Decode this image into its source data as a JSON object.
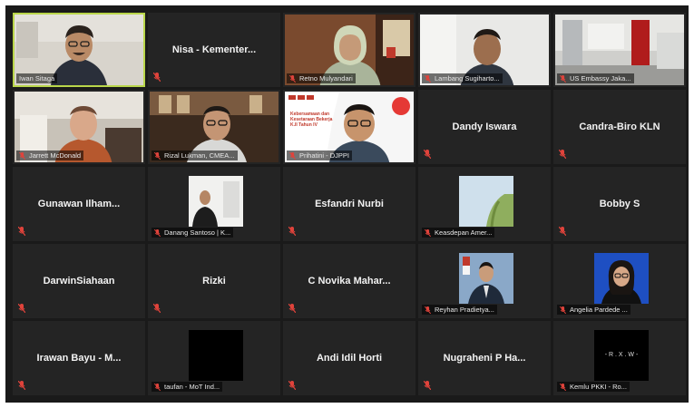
{
  "app": {
    "title": "Video meeting gallery view"
  },
  "colors": {
    "background": "#1a1a1a",
    "tile": "#242424",
    "active_speaker": "#b9d64a",
    "muted_icon": "#e0433b"
  },
  "participants": [
    {
      "id": "p1",
      "label": "Iwan Sitaga",
      "video": true,
      "active": true,
      "muted": false
    },
    {
      "id": "p2",
      "label": "Nisa - Kementer...",
      "video": false,
      "muted": true
    },
    {
      "id": "p3",
      "label": "Retno Mulyandari",
      "video": true,
      "muted": true
    },
    {
      "id": "p4",
      "label": "Lambang Sugiharto...",
      "video": true,
      "muted": true
    },
    {
      "id": "p5",
      "label": "US Embassy Jaka...",
      "video": true,
      "muted": true
    },
    {
      "id": "p6",
      "label": "Jarrett McDonald",
      "video": true,
      "muted": true
    },
    {
      "id": "p7",
      "label": "Rizal Lukman, CMEA...",
      "video": true,
      "muted": true
    },
    {
      "id": "p8",
      "label": "Prihatini - DJPPI",
      "video": true,
      "muted": true
    },
    {
      "id": "p9",
      "label": "Dandy Iswara",
      "video": false,
      "muted": true
    },
    {
      "id": "p10",
      "label": "Candra-Biro KLN",
      "video": false,
      "muted": true
    },
    {
      "id": "p11",
      "label": "Gunawan Ilham...",
      "video": false,
      "muted": true
    },
    {
      "id": "p12",
      "label": "Danang Santoso | K...",
      "video": true,
      "muted": true
    },
    {
      "id": "p13",
      "label": "Esfandri Nurbi",
      "video": false,
      "muted": true
    },
    {
      "id": "p14",
      "label": "Keasdepan Amer...",
      "video": true,
      "muted": true
    },
    {
      "id": "p15",
      "label": "Bobby S",
      "video": false,
      "muted": true
    },
    {
      "id": "p16",
      "label": "DarwinSiahaan",
      "video": false,
      "muted": true
    },
    {
      "id": "p17",
      "label": "Rizki",
      "video": false,
      "muted": true
    },
    {
      "id": "p18",
      "label": "C Novika Mahar...",
      "video": false,
      "muted": true
    },
    {
      "id": "p19",
      "label": "Reyhan Pradietya...",
      "video": true,
      "muted": true
    },
    {
      "id": "p20",
      "label": "Angelia Pardede ...",
      "video": true,
      "muted": true
    },
    {
      "id": "p21",
      "label": "Irawan Bayu - M...",
      "video": false,
      "muted": true
    },
    {
      "id": "p22",
      "label": "taufan - MoT Ind...",
      "video": true,
      "muted": true
    },
    {
      "id": "p23",
      "label": "Andi Idil Horti",
      "video": false,
      "muted": true
    },
    {
      "id": "p24",
      "label": "Nugraheni P Ha...",
      "video": false,
      "muted": true
    },
    {
      "id": "p25",
      "label": "Kemlu PKKI - Ro...",
      "video": true,
      "muted": true
    }
  ],
  "tile_texts": {
    "p8_banner": "Kebersamaan dan Kesetaraan Bekerja K.II Tahun IV",
    "p25_overlay": "- R . X . W -"
  },
  "icons": {
    "muted": "microphone-muted-icon"
  }
}
